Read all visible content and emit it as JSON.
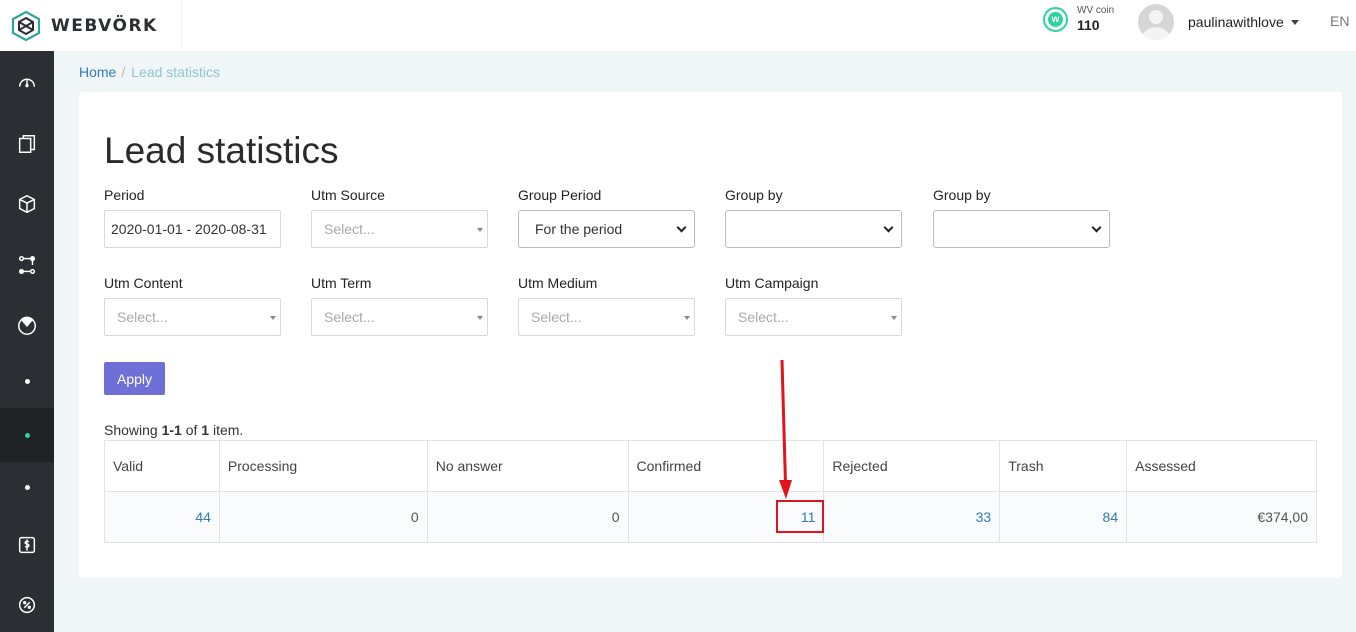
{
  "header": {
    "brand": "WEBVÖRK",
    "coin_label": "WV coin",
    "coin_value": "110",
    "coin_symbol": "w",
    "username": "paulinawithlove",
    "language": "EN"
  },
  "sidebar": {
    "items": [
      {
        "name": "dashboard",
        "icon": "speedometer-icon"
      },
      {
        "name": "offers",
        "icon": "documents-icon"
      },
      {
        "name": "products",
        "icon": "box-icon"
      },
      {
        "name": "flows",
        "icon": "flow-icon"
      },
      {
        "name": "statistics",
        "icon": "pie-chart-icon"
      },
      {
        "name": "sub-item-1",
        "icon": "dot-icon"
      },
      {
        "name": "sub-item-2",
        "icon": "dot-icon",
        "active": true
      },
      {
        "name": "sub-item-3",
        "icon": "dot-icon"
      },
      {
        "name": "finance",
        "icon": "dollar-icon"
      },
      {
        "name": "settings",
        "icon": "percent-gear-icon"
      }
    ]
  },
  "breadcrumb": {
    "home": "Home",
    "separator": "/",
    "current": "Lead statistics"
  },
  "page": {
    "title": "Lead statistics"
  },
  "filters": {
    "period": {
      "label": "Period",
      "value": "2020-01-01 - 2020-08-31"
    },
    "utm_source": {
      "label": "Utm Source",
      "placeholder": "Select..."
    },
    "group_period": {
      "label": "Group Period",
      "value": "For the period"
    },
    "group_by_1": {
      "label": "Group by",
      "value": ""
    },
    "group_by_2": {
      "label": "Group by",
      "value": ""
    },
    "utm_content": {
      "label": "Utm Content",
      "placeholder": "Select..."
    },
    "utm_term": {
      "label": "Utm Term",
      "placeholder": "Select..."
    },
    "utm_medium": {
      "label": "Utm Medium",
      "placeholder": "Select..."
    },
    "utm_campaign": {
      "label": "Utm Campaign",
      "placeholder": "Select..."
    },
    "apply_label": "Apply"
  },
  "summary": {
    "prefix": "Showing",
    "range": "1-1",
    "of": "of",
    "total": "1",
    "suffix": "item."
  },
  "table": {
    "headers": [
      "Valid",
      "Processing",
      "No answer",
      "Confirmed",
      "Rejected",
      "Trash",
      "Assessed"
    ],
    "row": [
      "44",
      "0",
      "0",
      "11",
      "33",
      "84",
      "€374,00"
    ]
  },
  "colors": {
    "accent": "#6f6fd8",
    "link": "#337ab7",
    "coin": "#2fd3a3",
    "sidebar": "#2b2f33",
    "annotation": "#e0141a"
  }
}
